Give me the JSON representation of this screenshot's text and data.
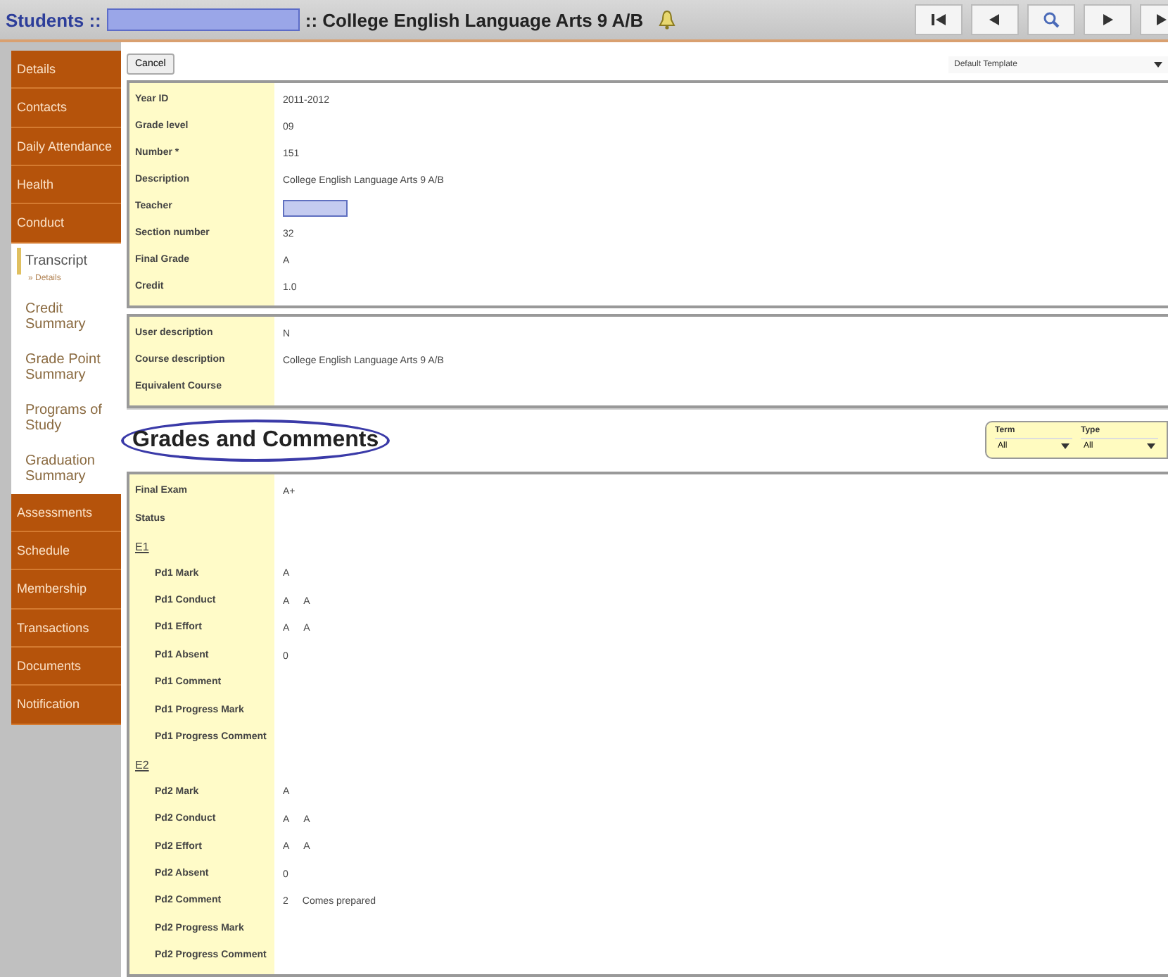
{
  "header": {
    "section": "Students ::",
    "separator": ":: College English Language Arts 9 A/B"
  },
  "nav_buttons": [
    {
      "kind": "first"
    },
    {
      "kind": "prev"
    },
    {
      "kind": "search"
    },
    {
      "kind": "next"
    },
    {
      "kind": "last"
    }
  ],
  "sidebar": [
    {
      "label": "Details",
      "kind": "main",
      "selected": false
    },
    {
      "label": "Contacts",
      "kind": "main",
      "selected": false
    },
    {
      "label": "Daily Attendance",
      "kind": "main",
      "selected": false
    },
    {
      "label": "Health",
      "kind": "main",
      "selected": false
    },
    {
      "label": "Conduct",
      "kind": "main",
      "selected": false
    },
    {
      "label": "Transcript",
      "kind": "sub",
      "selected": true,
      "children": [
        {
          "label": "» Details"
        }
      ]
    },
    {
      "label": "Credit Summary",
      "kind": "sub",
      "selected": false
    },
    {
      "label": "Grade Point Summary",
      "kind": "sub",
      "selected": false
    },
    {
      "label": "Programs of Study",
      "kind": "sub",
      "selected": false
    },
    {
      "label": "Graduation Summary",
      "kind": "sub",
      "selected": false
    },
    {
      "label": "Assessments",
      "kind": "main",
      "selected": false
    },
    {
      "label": "Schedule",
      "kind": "main",
      "selected": false
    },
    {
      "label": "Membership",
      "kind": "main",
      "selected": false
    },
    {
      "label": "Transactions",
      "kind": "main",
      "selected": false
    },
    {
      "label": "Documents",
      "kind": "main",
      "selected": false
    },
    {
      "label": "Notification",
      "kind": "main",
      "selected": false
    }
  ],
  "toolbar": {
    "cancel": "Cancel",
    "template": "Default Template"
  },
  "course_fields": [
    {
      "label": "Year ID",
      "values": [
        "2011-2012"
      ]
    },
    {
      "label": "Grade level",
      "values": [
        "09"
      ]
    },
    {
      "label": "Number *",
      "values": [
        "151"
      ]
    },
    {
      "label": "Description",
      "values": [
        "College English Language Arts 9 A/B"
      ]
    },
    {
      "label": "Teacher",
      "kind": "redacted"
    },
    {
      "label": "Section number",
      "values": [
        "32"
      ]
    },
    {
      "label": "Final Grade",
      "values": [
        "A"
      ]
    },
    {
      "label": "Credit",
      "values": [
        "1.0"
      ]
    }
  ],
  "extra_fields": [
    {
      "label": "User description",
      "values": [
        "N"
      ]
    },
    {
      "label": "Course description",
      "values": [
        "College English Language Arts 9 A/B"
      ]
    },
    {
      "label": "Equivalent Course"
    }
  ],
  "grades": {
    "title": "Grades and Comments",
    "filters": [
      {
        "label": "Term",
        "value": "All"
      },
      {
        "label": "Type",
        "value": "All"
      }
    ],
    "rows": [
      {
        "label": "Final Exam",
        "kind": "field",
        "values": [
          "A+"
        ]
      },
      {
        "label": "Status",
        "kind": "field"
      },
      {
        "label": "E1",
        "kind": "group"
      },
      {
        "label": "Pd1 Mark",
        "kind": "indent",
        "values": [
          "A"
        ]
      },
      {
        "label": "Pd1 Conduct",
        "kind": "indent",
        "values": [
          "A",
          "A"
        ]
      },
      {
        "label": "Pd1 Effort",
        "kind": "indent",
        "values": [
          "A",
          "A"
        ]
      },
      {
        "label": "Pd1 Absent",
        "kind": "indent",
        "values": [
          "0"
        ]
      },
      {
        "label": "Pd1 Comment",
        "kind": "indent"
      },
      {
        "label": "Pd1 Progress Mark",
        "kind": "indent"
      },
      {
        "label": "Pd1 Progress Comment",
        "kind": "indent"
      },
      {
        "label": "E2",
        "kind": "group"
      },
      {
        "label": "Pd2 Mark",
        "kind": "indent",
        "values": [
          "A"
        ]
      },
      {
        "label": "Pd2 Conduct",
        "kind": "indent",
        "values": [
          "A",
          "A"
        ]
      },
      {
        "label": "Pd2 Effort",
        "kind": "indent",
        "values": [
          "A",
          "A"
        ]
      },
      {
        "label": "Pd2 Absent",
        "kind": "indent",
        "values": [
          "0"
        ]
      },
      {
        "label": "Pd2 Comment",
        "kind": "indent",
        "values": [
          "2",
          "Comes prepared"
        ]
      },
      {
        "label": "Pd2 Progress Mark",
        "kind": "indent"
      },
      {
        "label": "Pd2 Progress Comment",
        "kind": "indent"
      }
    ]
  }
}
